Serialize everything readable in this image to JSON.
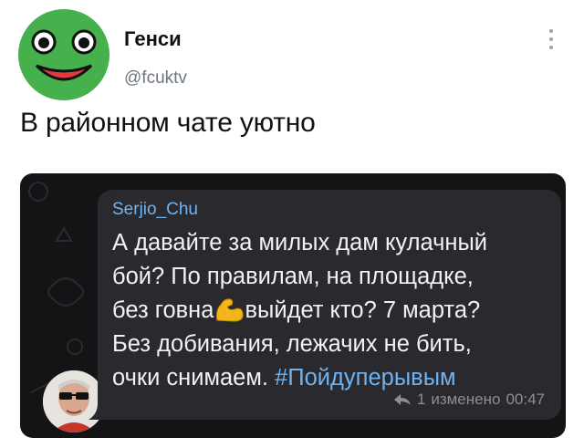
{
  "author": {
    "name": "Генси",
    "handle": "@fcuktv"
  },
  "tweet": {
    "text": "В районном чате уютно"
  },
  "chat_message": {
    "sender": "Serjio_Chu",
    "line1": "А давайте за милых дам кулачный",
    "line2": "бой? По правилам, на площадке,",
    "line3_before": "без говна",
    "line3_after": "выйдет кто? 7 марта?",
    "line4": "Без добивания, лежачих не бить,",
    "line5": "очки снимаем.",
    "hashtag": "#Пойдуперывым",
    "reply_count": "1",
    "edited_label": "изменено",
    "time": "00:47"
  },
  "icons": {
    "more": "more-vertical-icon",
    "reply": "reply-icon",
    "emoji": "flexed-biceps-icon"
  },
  "colors": {
    "accent": "#6fb3f2",
    "chat_bg": "#141416",
    "bubble": "#2a2a2e",
    "frog_green": "#46b04c"
  }
}
